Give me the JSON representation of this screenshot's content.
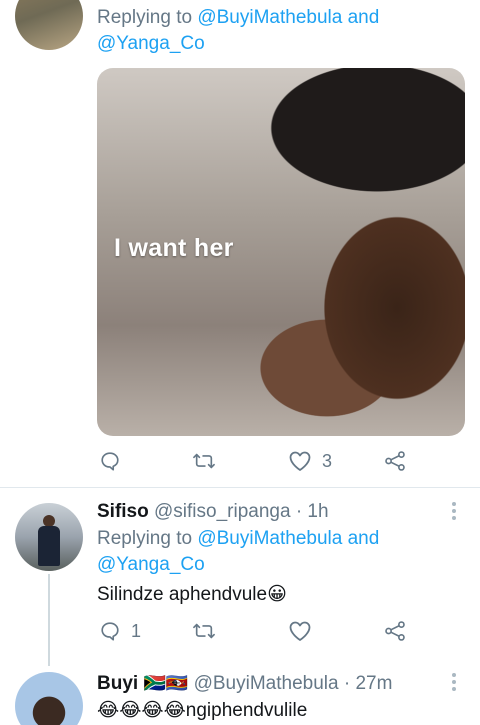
{
  "tweet1": {
    "replying_label": "Replying to",
    "mention_1": "@BuyiMathebula",
    "and_label": "and",
    "mention_2": "@Yanga_Co",
    "media_caption": "I want her",
    "likes_count": "3"
  },
  "tweet2": {
    "display_name": "Sifiso",
    "handle": "@sifiso_ripanga",
    "time": "· 1h",
    "replying_label": "Replying to",
    "mention_1": "@BuyiMathebula",
    "and_label": "and",
    "mention_2": "@Yanga_Co",
    "text": "Silindze aphendvule😀",
    "replies_count": "1"
  },
  "tweet3": {
    "display_name": "Buyi",
    "name_flags": "🇿🇦🇸🇿",
    "handle": "@BuyiMathebula",
    "time": "· 27m",
    "text": "😂😂😂😂ngiphendvulile"
  },
  "icons": {
    "reply": "reply-icon",
    "retweet": "retweet-icon",
    "like": "heart-icon",
    "share": "share-icon",
    "menu": "more-vertical-icon"
  },
  "colors": {
    "link": "#1da1f2",
    "muted": "#657786",
    "text": "#14171a",
    "divider": "#e1e8ed"
  }
}
